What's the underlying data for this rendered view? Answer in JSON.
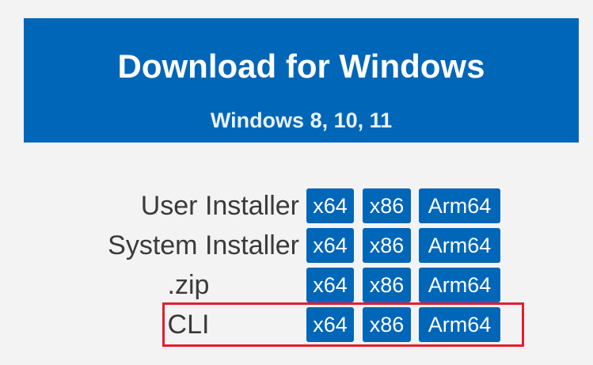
{
  "banner": {
    "title": "Download for Windows",
    "subtitle": "Windows 8, 10, 11"
  },
  "rows": [
    {
      "label": "User Installer",
      "buttons": [
        "x64",
        "x86",
        "Arm64"
      ]
    },
    {
      "label": "System Installer",
      "buttons": [
        "x64",
        "x86",
        "Arm64"
      ]
    },
    {
      "label": ".zip",
      "buttons": [
        "x64",
        "x86",
        "Arm64"
      ]
    },
    {
      "label": "CLI",
      "buttons": [
        "x64",
        "x86",
        "Arm64"
      ]
    }
  ],
  "colors": {
    "accent": "#0066b8",
    "page_background": "#f3f3f3",
    "highlight": "#e01f2d",
    "label_text": "#3a3a3a"
  }
}
